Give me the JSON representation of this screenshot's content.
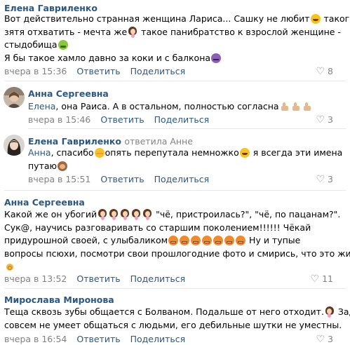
{
  "comments": [
    {
      "author": "Елена Гавриленко",
      "lines": [
        [
          "Вот действительно странная женщина Лариса... Сашку не любит",
          "smile",
          " такого"
        ],
        [
          "зятя отхватить - мечта же",
          "woman",
          " такое панибратство к взрослой женщине -"
        ],
        [
          "стыдобища",
          "sick"
        ],
        [
          "Я бы такое хамло давно за коки и с балкона",
          "devil"
        ]
      ],
      "time": "вчера в 15:36",
      "reply": "Ответить",
      "share": "Поделиться",
      "likes": "8"
    },
    {
      "author": "Анна Сергеевна",
      "mention": "Елена",
      "lines": [
        [
          ", она Раиса. А в остальном, полностью согласна",
          "thumb",
          "thumb",
          "thumb"
        ]
      ],
      "time": "вчера в 15:46",
      "reply": "Ответить",
      "share": "Поделиться",
      "likes": "3"
    },
    {
      "author": "Елена Гавриленко",
      "reply_to": "ответила Анне",
      "mention": "Анна",
      "lines": [
        [
          ", спасибо",
          "blush",
          "опять перепутала немножко",
          "smile",
          " я всегда эти имена"
        ],
        [
          "путаю",
          "monkey"
        ]
      ],
      "time": "вчера в 15:51",
      "reply": "Ответить",
      "share": "Поделиться",
      "likes": "3"
    },
    {
      "author": "Анна Сергеевна",
      "lines": [
        [
          "Какой же он убогий",
          "woman",
          "woman",
          "woman",
          "woman",
          "woman",
          " \"чё, пристроилась?\", \"чё, по пацанам?\"."
        ],
        [
          "Сук@, научись разговаривать со старшим поколением!!!!!! Чёкай"
        ],
        [
          "придурошной своей, с улыбаликом",
          "angry",
          "angry",
          "angry",
          "angry",
          "angry",
          "angry",
          "angry",
          " Ну и тупые"
        ],
        [
          "вопросы псюхи, посмотри свои прошлогодние фото и смирись, что это жир"
        ],
        [
          "",
          "ok"
        ]
      ],
      "time": "вчера в 13:52",
      "reply": "Ответить",
      "share": "Поделиться",
      "likes": "11"
    },
    {
      "author": "Мирослава Миронова",
      "lines": [
        [
          "Теща сквозь зубы общается с Болваном. Подальше от него отходит.",
          "woman",
          " Зад"
        ],
        [
          "совсем не умеет общаться с людьми, его дебильные шутки не уместны."
        ]
      ],
      "time": "вчера в 16:54",
      "reply": "Ответить",
      "share": "Поделиться",
      "likes": "3"
    }
  ],
  "icons": {
    "heart": "heart-icon",
    "emoji_names": [
      "smile",
      "woman",
      "sick",
      "devil",
      "thumb",
      "blush",
      "monkey",
      "angry",
      "ok"
    ]
  },
  "colors": {
    "author": "#2a5885",
    "meta": "#828282",
    "separator": "#e7e8ec"
  }
}
